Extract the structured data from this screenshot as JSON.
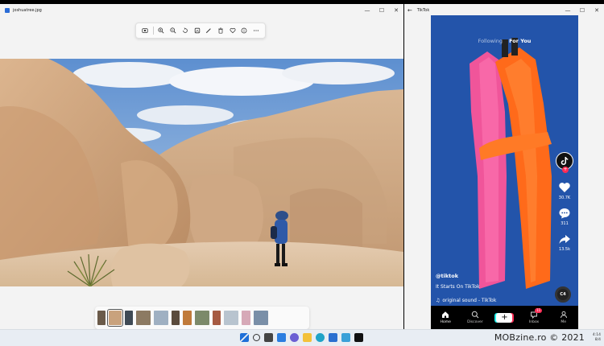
{
  "photos_window": {
    "filename": "joshuatree.jpg",
    "controls": {
      "minimize": "—",
      "maximize": "☐",
      "close": "✕"
    },
    "toolbar_icons": [
      "enhance-icon",
      "zoom-in-icon",
      "zoom-out-icon",
      "rotate-icon",
      "crop-icon",
      "edit-icon",
      "delete-icon",
      "favorite-icon",
      "info-icon",
      "more-icon"
    ],
    "filmstrip_count": 13
  },
  "tiktok_window": {
    "title": "TikTok",
    "back": "←",
    "controls": {
      "minimize": "—",
      "maximize": "☐",
      "close": "✕"
    },
    "feed_tabs": {
      "following": "Following",
      "for_you": "For You"
    },
    "actions": {
      "likes": "30.7K",
      "comments": "311",
      "shares": "13.5k"
    },
    "caption": {
      "user": "@tiktok",
      "description": "It Starts On TikTok",
      "sound": "original sound - TikTok"
    },
    "disc_label": "C4",
    "nav": {
      "home": "Home",
      "discover": "Discover",
      "create": "+",
      "inbox": "Inbox",
      "inbox_badge": "11",
      "me": "Me"
    },
    "colors": {
      "brand_red": "#fe2c55",
      "brand_cyan": "#25f4ee",
      "background": "#1e4c9e"
    }
  },
  "taskbar": {
    "watermark": "MOBzine.ro © 2021",
    "tray_line1": "4:14",
    "tray_line2": "8/4"
  }
}
